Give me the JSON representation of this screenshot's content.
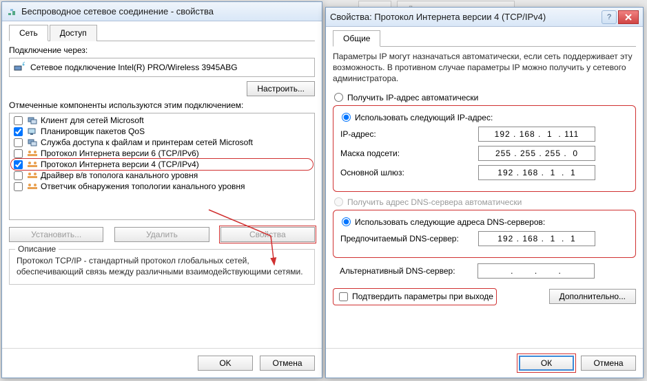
{
  "win1": {
    "title": "Беспроводное сетевое соединение - свойства",
    "tabs": {
      "network": "Сеть",
      "access": "Доступ"
    },
    "connect_via_label": "Подключение через:",
    "adapter": "Сетевое подключение Intel(R) PRO/Wireless 3945ABG",
    "configure_btn": "Настроить...",
    "components_label": "Отмеченные компоненты используются этим подключением:",
    "components": [
      {
        "label": "Клиент для сетей Microsoft",
        "checked": false
      },
      {
        "label": "Планировщик пакетов QoS",
        "checked": true
      },
      {
        "label": "Служба доступа к файлам и принтерам сетей Microsoft",
        "checked": false
      },
      {
        "label": "Протокол Интернета версии 6 (TCP/IPv6)",
        "checked": false
      },
      {
        "label": "Протокол Интернета версии 4 (TCP/IPv4)",
        "checked": true,
        "highlight": true
      },
      {
        "label": "Драйвер в/в тополога канального уровня",
        "checked": false
      },
      {
        "label": "Ответчик обнаружения топологии канального уровня",
        "checked": false
      }
    ],
    "install_btn": "Установить...",
    "remove_btn": "Удалить",
    "props_btn": "Свойства",
    "desc_title": "Описание",
    "desc_text": "Протокол TCP/IP - стандартный протокол глобальных сетей, обеспечивающий связь между различными взаимодействующими сетями.",
    "ok_btn": "OK",
    "cancel_btn": "Отмена"
  },
  "bg_tabs": {
    "a": "тва",
    "b": "Диагностика подключени"
  },
  "win2": {
    "title": "Свойства: Протокол Интернета версии 4 (TCP/IPv4)",
    "tab": "Общие",
    "intro": "Параметры IP могут назначаться автоматически, если сеть поддерживает эту возможность. В противном случае параметры IP можно получить у сетевого администратора.",
    "auto_ip": "Получить IP-адрес автоматически",
    "use_ip": "Использовать следующий IP-адрес:",
    "ip_label": "IP-адрес:",
    "ip_value": "192 . 168 .  1  . 111",
    "mask_label": "Маска подсети:",
    "mask_value": "255 . 255 . 255 .  0",
    "gw_label": "Основной шлюз:",
    "gw_value": "192 . 168 .  1  .  1",
    "auto_dns": "Получить адрес DNS-сервера автоматически",
    "use_dns": "Использовать следующие адреса DNS-серверов:",
    "dns1_label": "Предпочитаемый DNS-сервер:",
    "dns1_value": "192 . 168 .  1  .  1",
    "dns2_label": "Альтернативный DNS-сервер:",
    "dns2_value": ".       .       .",
    "confirm_label": "Подтвердить параметры при выходе",
    "advanced_btn": "Дополнительно...",
    "ok_btn": "ОК",
    "cancel_btn": "Отмена"
  }
}
